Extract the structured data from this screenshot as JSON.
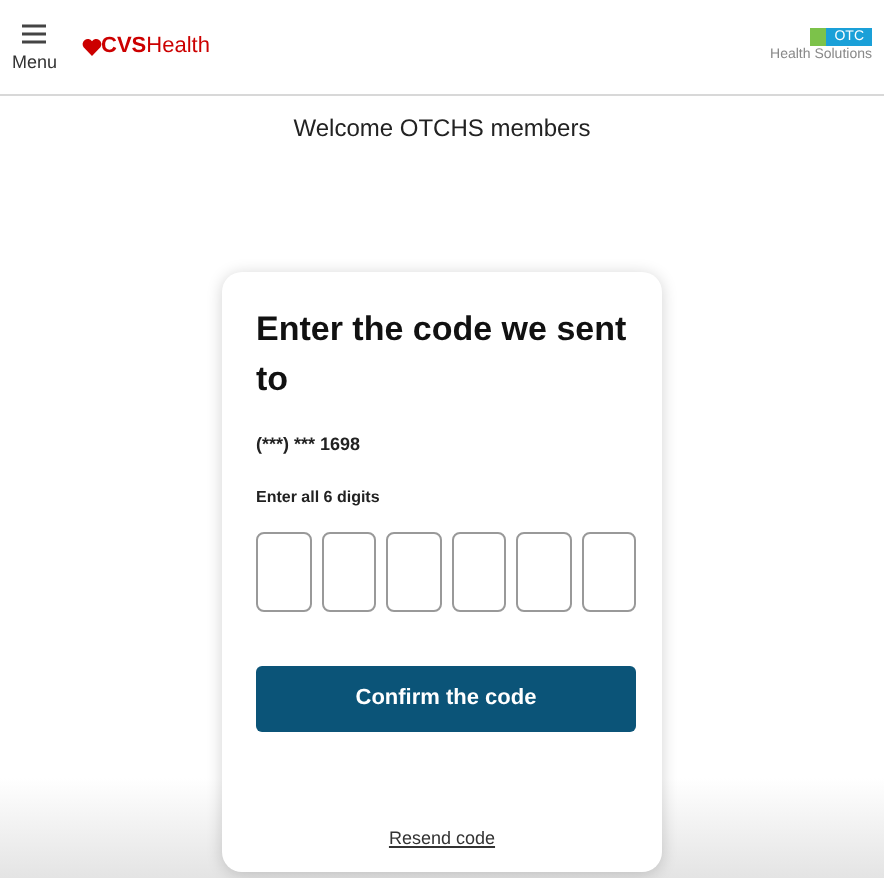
{
  "header": {
    "menu_label": "Menu",
    "brand": {
      "bold": "CVS",
      "rest": "Health"
    },
    "partner": {
      "badge": "OTC",
      "subtitle": "Health Solutions"
    }
  },
  "welcome": "Welcome OTCHS members",
  "card": {
    "title": "Enter the code we sent to",
    "phone": "(***) *** 1698",
    "digits_label": "Enter all 6 digits",
    "digits": [
      {
        "filled": false
      },
      {
        "filled": false
      },
      {
        "filled": false
      },
      {
        "filled": false
      },
      {
        "filled": false
      },
      {
        "filled": false
      }
    ],
    "confirm_button": "Confirm the code",
    "resend_link": "Resend code"
  }
}
